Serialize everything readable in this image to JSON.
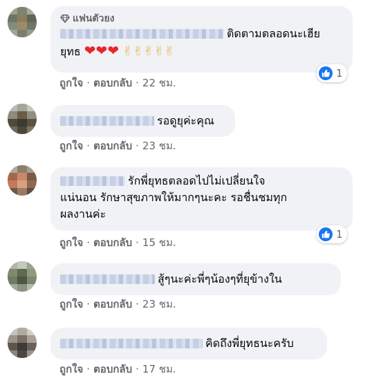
{
  "comments": [
    {
      "badge": "แฟนตัวยง",
      "text_line1": "ติดตามตลอดนะเฮีย",
      "text_line2": "ยุทธ",
      "hearts": [
        "❤",
        "❤",
        "❤"
      ],
      "hands": [
        "✌",
        "✌",
        "✌",
        "✌",
        "✌"
      ],
      "actions": {
        "like": "ถูกใจ",
        "reply": "ตอบกลับ",
        "sep": "·",
        "time": "22 ชม."
      },
      "reactions": {
        "count": "1"
      }
    },
    {
      "text": "รอดูยุค่ะคุณ",
      "actions": {
        "like": "ถูกใจ",
        "reply": "ตอบกลับ",
        "sep": "·",
        "time": "23 ชม."
      }
    },
    {
      "text_line1": "รักพี่ยุทธตลอดไปไม่เปลี่ยนใจ",
      "text_line2": "แน่นอน รักษาสุขภาพให้มากๆนะคะ รอชื่นชมทุก",
      "text_line3": "ผลงานค่ะ",
      "actions": {
        "like": "ถูกใจ",
        "reply": "ตอบกลับ",
        "sep": "·",
        "time": "15 ชม."
      },
      "reactions": {
        "count": "1"
      }
    },
    {
      "text": "สู้ๆนะค่ะพี่ๆน้องๆที่ยุข้างใน",
      "actions": {
        "like": "ถูกใจ",
        "reply": "ตอบกลับ",
        "sep": "·",
        "time": "23 ชม."
      }
    },
    {
      "text": "คิดถึงพี่ยุทธนะครับ",
      "actions": {
        "like": "ถูกใจ",
        "reply": "ตอบกลับ",
        "sep": "·",
        "time": "17 ชม."
      }
    }
  ],
  "colors": {
    "bubble": "#f0f2f5",
    "meta_text": "#65676b",
    "like_blue": "#1877f2",
    "text": "#050505"
  },
  "icons": {
    "badge": "diamond-icon",
    "reaction": "like-thumb-icon"
  }
}
